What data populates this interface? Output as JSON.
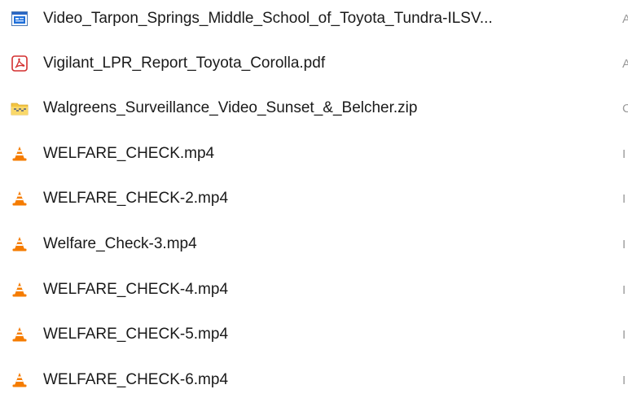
{
  "files": [
    {
      "name": "Video_Tarpon_Springs_Middle_School_of_Toyota_Tundra-ILSV...",
      "icon": "video-player-icon",
      "edge": "A"
    },
    {
      "name": "Vigilant_LPR_Report_Toyota_Corolla.pdf",
      "icon": "pdf-icon",
      "edge": "A"
    },
    {
      "name": "Walgreens_Surveillance_Video_Sunset_&_Belcher.zip",
      "icon": "zip-folder-icon",
      "edge": "C"
    },
    {
      "name": "WELFARE_CHECK.mp4",
      "icon": "vlc-icon",
      "edge": "I"
    },
    {
      "name": "WELFARE_CHECK-2.mp4",
      "icon": "vlc-icon",
      "edge": "I"
    },
    {
      "name": "Welfare_Check-3.mp4",
      "icon": "vlc-icon",
      "edge": "I"
    },
    {
      "name": "WELFARE_CHECK-4.mp4",
      "icon": "vlc-icon",
      "edge": "I"
    },
    {
      "name": "WELFARE_CHECK-5.mp4",
      "icon": "vlc-icon",
      "edge": "I"
    },
    {
      "name": "WELFARE_CHECK-6.mp4",
      "icon": "vlc-icon",
      "edge": "I"
    }
  ],
  "colors": {
    "pdf_red": "#d32f2f",
    "zip_yellow": "#f4c542",
    "vlc_orange": "#f57c00",
    "video_blue": "#1e6fd9"
  }
}
